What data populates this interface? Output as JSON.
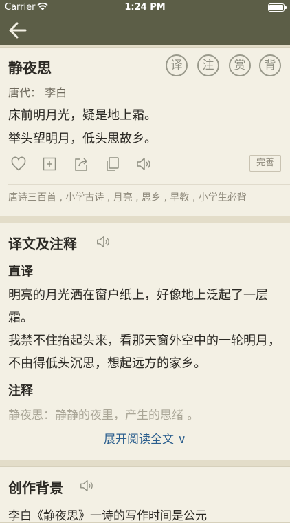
{
  "status": {
    "carrier": "Carrier",
    "time": "1:24 PM"
  },
  "poem": {
    "title": "静夜思",
    "seals": [
      "译",
      "注",
      "赏",
      "背"
    ],
    "author_line": "唐代： 李白",
    "lines": [
      "床前明月光，疑是地上霜。",
      "举头望明月，低头思故乡。"
    ],
    "perfect_label": "完善",
    "tags": "唐诗三百首 , 小学古诗 , 月亮 , 思乡 , 早教 , 小学生必背"
  },
  "translation": {
    "title": "译文及注释",
    "direct_heading": "直译",
    "paragraphs": [
      "明亮的月光洒在窗户纸上，好像地上泛起了一层霜。",
      "我禁不住抬起头来，看那天窗外空中的一轮明月，不由得低头沉思，想起远方的家乡。"
    ],
    "notes_heading": "注释",
    "note_preview": "静夜思：静静的夜里，产生的思绪 。",
    "expand_label": "展开阅读全文 ∨"
  },
  "background": {
    "title": "创作背景",
    "preview": "李白《静夜思》一诗的写作时间是公元"
  }
}
